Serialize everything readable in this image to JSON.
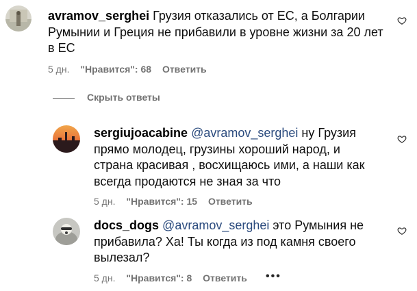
{
  "comments": [
    {
      "username": "avramov_serghei",
      "mention": "",
      "text": " Грузия отказались от ЕС, а Болгарии Румынии и Греция не прибавили в уровне жизни за 20 лет в ЕС",
      "time": "5 дн.",
      "likes": "\"Нравится\": 68",
      "reply": "Ответить"
    },
    {
      "username": "sergiujoacabine",
      "mention": "@avramov_serghei",
      "text": " ну Грузия прямо молодец, грузины хороший народ, и страна красивая , восхищаюсь ими, а наши как всегда продаются не зная за что",
      "time": "5 дн.",
      "likes": "\"Нравится\": 15",
      "reply": "Ответить"
    },
    {
      "username": "docs_dogs",
      "mention": "@avramov_serghei",
      "text": " это Румыния не прибавила? Ха! Ты когда из под камня своего вылезал?",
      "time": "5 дн.",
      "likes": "\"Нравится\": 8",
      "reply": "Ответить"
    }
  ],
  "hide_replies": "Скрыть ответы",
  "more_icon": "•••",
  "colors": {
    "meta": "#737373",
    "mention": "#2a4a7d"
  }
}
